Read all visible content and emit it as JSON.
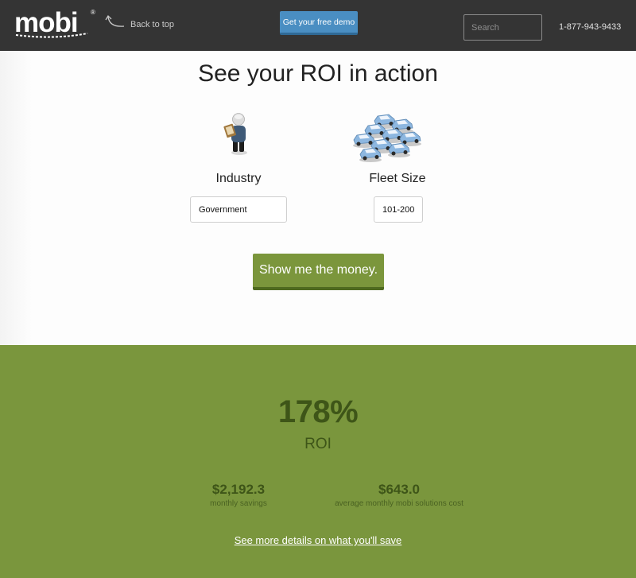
{
  "header": {
    "logo_text": "mobi",
    "logo_mark": "®",
    "back_to_top": "Back to top",
    "demo_button": "Get your free demo",
    "search_placeholder": "Search",
    "phone": "1-877-943-9433",
    "icons": {
      "back": "curved-arrow-icon"
    }
  },
  "main": {
    "title": "See your ROI in action",
    "industry": {
      "label": "Industry",
      "value": "Government",
      "illustration": "person-with-clipboard-icon"
    },
    "fleet": {
      "label": "Fleet Size",
      "value": "101-200",
      "illustration": "fleet-cars-icon"
    },
    "cta": "Show me the money."
  },
  "results": {
    "roi_value": "178%",
    "roi_label": "ROI",
    "savings": {
      "value": "$2,192.3",
      "caption": "monthly savings"
    },
    "cost": {
      "value": "$643.0",
      "caption": "average monthly mobi solutions cost"
    },
    "details_link": "See more details on what you'll save"
  },
  "colors": {
    "header_bg": "#343434",
    "demo_blue": "#4a8ec2",
    "green": "#7a963d",
    "dark_green": "#3e5518"
  }
}
